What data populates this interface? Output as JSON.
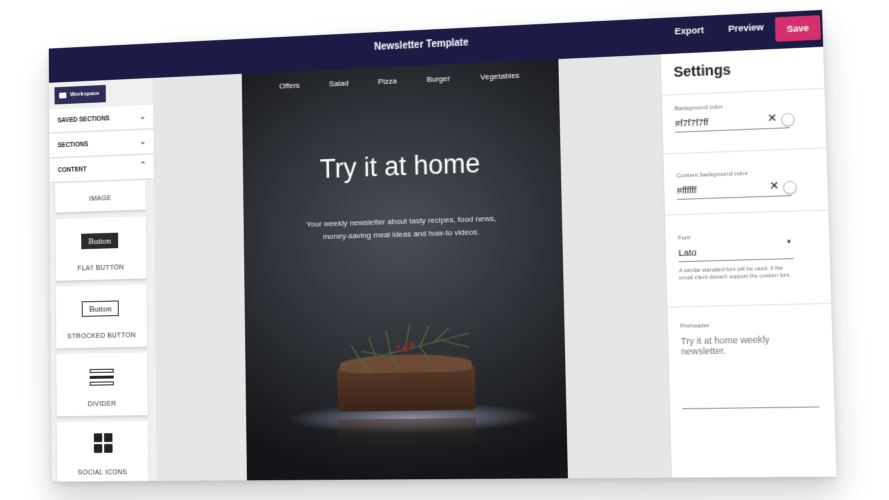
{
  "topbar": {
    "title": "Newsletter Template",
    "export_label": "Export",
    "preview_label": "Preview",
    "save_label": "Save",
    "background": "#1c1b45",
    "save_color": "#d4306d"
  },
  "sidebar": {
    "workspace_label": "Workspace",
    "accordions": [
      {
        "label": "SAVED SECTIONS",
        "icon": "chevron-down-icon"
      },
      {
        "label": "SECTIONS",
        "icon": "chevron-down-icon"
      },
      {
        "label": "CONTENT",
        "icon": "chevron-up-icon"
      }
    ],
    "blocks": [
      {
        "label": "IMAGE"
      },
      {
        "label": "FLAT BUTTON",
        "preview_text": "Button"
      },
      {
        "label": "STROCKED BUTTON",
        "preview_text": "Button"
      },
      {
        "label": "DIVIDER"
      },
      {
        "label": "SOCIAL ICONS"
      }
    ]
  },
  "email": {
    "nav": [
      "Offers",
      "Salad",
      "Pizza",
      "Burger",
      "Vegetables"
    ],
    "hero_title": "Try it at home",
    "subtitle_line1": "Your weekly  newsletter about tasty recipes, food news,",
    "subtitle_line2": "money-saving meal ideas and how-to videos."
  },
  "settings": {
    "title": "Settings",
    "background_color": {
      "label": "Background color",
      "value": "#f7f7f7ff"
    },
    "content_background_color": {
      "label": "Content background color",
      "value": "#ffffff"
    },
    "font": {
      "label": "Font",
      "value": "Lato",
      "help": "A similar standard font will be used, if the email client doesn't support the custom font."
    },
    "preheader": {
      "label": "Preheader",
      "placeholder": "Try it at home weekly newsletter."
    }
  }
}
